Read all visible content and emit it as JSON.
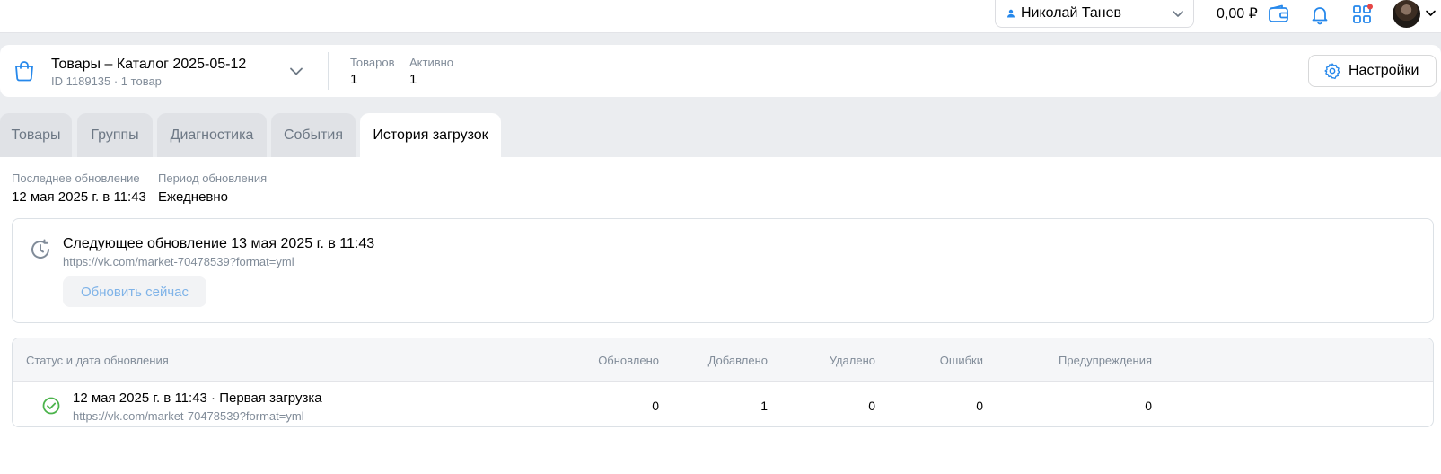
{
  "topbar": {
    "user_name": "Николай Танев",
    "balance": "0,00 ₽",
    "icons": [
      "wallet-icon",
      "bell-icon",
      "apps-icon",
      "avatar"
    ],
    "notification_dot_color": "#e64646"
  },
  "catalog": {
    "title": "Товары – Каталог 2025-05-12",
    "subtitle": "ID 1189135 · 1 товар",
    "stats": [
      {
        "label": "Товаров",
        "value": "1"
      },
      {
        "label": "Активно",
        "value": "1"
      }
    ],
    "settings_label": "Настройки"
  },
  "tabs": [
    {
      "label": "Товары",
      "active": false
    },
    {
      "label": "Группы",
      "active": false
    },
    {
      "label": "Диагностика",
      "active": false
    },
    {
      "label": "События",
      "active": false
    },
    {
      "label": "История загрузок",
      "active": true
    }
  ],
  "meta": {
    "last_update_label": "Последнее обновление",
    "last_update_value": "12 мая 2025 г. в 11:43",
    "period_label": "Период обновления",
    "period_value": "Ежедневно"
  },
  "next_update": {
    "title": "Следующее обновление 13 мая 2025 г. в 11:43",
    "url": "https://vk.com/market-70478539?format=yml",
    "button_label": "Обновить сейчас"
  },
  "history": {
    "columns": [
      "Статус и дата обновления",
      "Обновлено",
      "Добавлено",
      "Удалено",
      "Ошибки",
      "Предупреждения"
    ],
    "rows": [
      {
        "status": "success",
        "title": "12 мая 2025 г. в 11:43 · Первая загрузка",
        "url": "https://vk.com/market-70478539?format=yml",
        "updated": "0",
        "added": "1",
        "deleted": "0",
        "errors": "0",
        "warnings": "0"
      }
    ]
  },
  "colors": {
    "accent": "#2688eb",
    "success": "#4bb34b",
    "muted_text": "#818c99",
    "tab_inactive_text": "#6d7885"
  }
}
